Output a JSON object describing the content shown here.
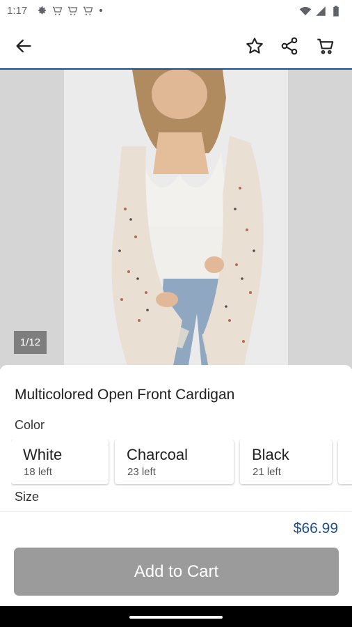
{
  "status_bar": {
    "time": "1:17",
    "left_icons": [
      "settings-icon",
      "cart-icon",
      "cart-icon",
      "cart-icon",
      "dot-icon"
    ],
    "right_icons": [
      "wifi-icon",
      "signal-icon",
      "battery-icon"
    ]
  },
  "app_bar": {
    "icons": [
      "back-arrow-icon",
      "star-icon",
      "share-icon",
      "cart-icon"
    ],
    "accent_color": "#1e4f8a"
  },
  "gallery": {
    "counter": "1/12"
  },
  "product": {
    "title": "Multicolored Open Front Cardigan",
    "color_label": "Color",
    "size_label": "Size",
    "colors": [
      {
        "name": "White",
        "stock": "18 left"
      },
      {
        "name": "Charcoal",
        "stock": "23 left"
      },
      {
        "name": "Black",
        "stock": "21 left"
      }
    ]
  },
  "footer": {
    "price": "$66.99",
    "add_to_cart": "Add to Cart",
    "button_color": "#9b9b9b"
  }
}
